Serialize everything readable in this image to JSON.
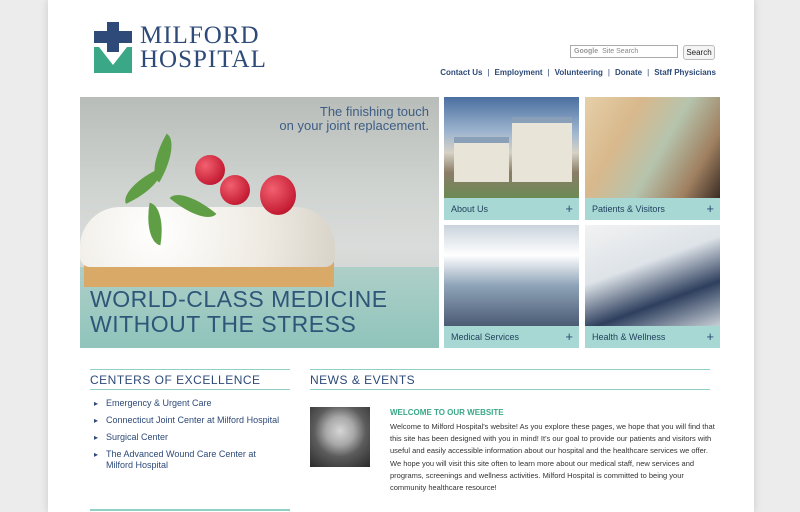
{
  "logo": {
    "line1": "MILFORD",
    "line2": "HOSPITAL"
  },
  "search": {
    "google_label": "Google",
    "placeholder": "Site Search",
    "button_label": "Search"
  },
  "topnav": [
    "Contact Us",
    "Employment",
    "Volunteering",
    "Donate",
    "Staff Physicians"
  ],
  "hero": {
    "tagline_line1": "The finishing touch",
    "tagline_line2": "on your joint replacement.",
    "headline_line1": "WORLD-CLASS MEDICINE",
    "headline_line2": "WITHOUT THE STRESS"
  },
  "tiles": [
    {
      "label": "About Us",
      "plus": "+"
    },
    {
      "label": "Patients & Visitors",
      "plus": "+"
    },
    {
      "label": "Medical Services",
      "plus": "+"
    },
    {
      "label": "Health & Wellness",
      "plus": "+"
    }
  ],
  "centers": {
    "title": "CENTERS OF EXCELLENCE",
    "items": [
      "Emergency & Urgent Care",
      "Connecticut Joint Center at Milford Hospital",
      "Surgical Center",
      "The Advanced Wound Care Center at Milford Hospital"
    ]
  },
  "news": {
    "title": "NEWS & EVENTS",
    "headline": "WELCOME TO OUR WEBSITE",
    "body": "Welcome to Milford Hospital's website! As you explore these pages, we hope that you will find that this site has been designed with you in mind! It's our goal to provide our patients and visitors with useful and easily accessible information about our hospital and the healthcare services we offer. We hope you will visit this site often to learn more about our medical staff, new services and programs, screenings and wellness activities. Milford Hospital is committed to being your community healthcare resource!"
  },
  "colors": {
    "navy": "#2d4a78",
    "green": "#3aa886",
    "teal_bar": "#a7d8d3"
  }
}
